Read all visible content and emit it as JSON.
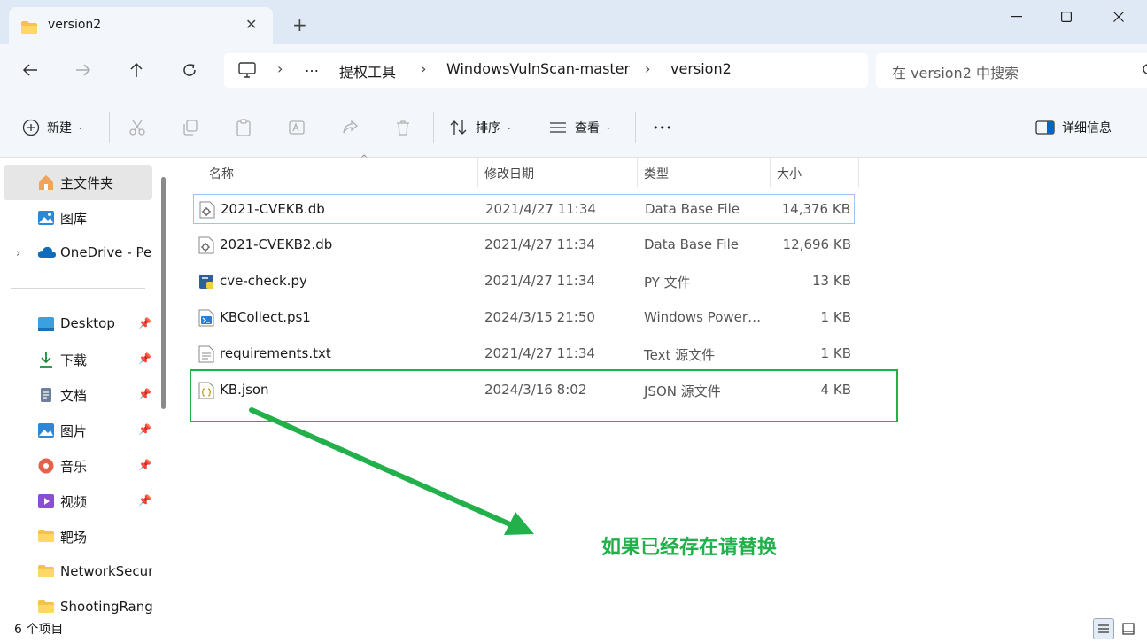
{
  "window": {
    "tab_title": "version2",
    "new_tab_symbol": "+"
  },
  "address": {
    "more": "…",
    "crumbs": [
      "提权工具",
      "WindowsVulnScan-master",
      "version2"
    ]
  },
  "search": {
    "placeholder": "在 version2 中搜索"
  },
  "toolbar": {
    "new_label": "新建",
    "sort_label": "排序",
    "view_label": "查看",
    "more_label": "•••",
    "details_label": "详细信息"
  },
  "sidebar": {
    "items": [
      {
        "label": "主文件夹",
        "icon": "home-icon"
      },
      {
        "label": "图库",
        "icon": "gallery-icon"
      },
      {
        "label": "OneDrive - Per",
        "icon": "onedrive-icon"
      },
      {
        "label": "Desktop",
        "icon": "desktop-icon",
        "pinned": true
      },
      {
        "label": "下载",
        "icon": "download-icon",
        "pinned": true
      },
      {
        "label": "文档",
        "icon": "documents-icon",
        "pinned": true
      },
      {
        "label": "图片",
        "icon": "pictures-icon",
        "pinned": true
      },
      {
        "label": "音乐",
        "icon": "music-icon",
        "pinned": true
      },
      {
        "label": "视频",
        "icon": "videos-icon",
        "pinned": true
      },
      {
        "label": "靶场",
        "icon": "folder-icon"
      },
      {
        "label": "NetworkSecuri",
        "icon": "folder-icon"
      },
      {
        "label": "ShootingRange",
        "icon": "folder-icon"
      }
    ]
  },
  "columns": {
    "name": "名称",
    "modified": "修改日期",
    "type": "类型",
    "size": "大小"
  },
  "files": [
    {
      "name": "2021-CVEKB.db",
      "modified": "2021/4/27 11:34",
      "type": "Data Base File",
      "size": "14,376 KB",
      "icon": "db-file-icon",
      "selected": true
    },
    {
      "name": "2021-CVEKB2.db",
      "modified": "2021/4/27 11:34",
      "type": "Data Base File",
      "size": "12,696 KB",
      "icon": "db-file-icon"
    },
    {
      "name": "cve-check.py",
      "modified": "2021/4/27 11:34",
      "type": "PY 文件",
      "size": "13 KB",
      "icon": "python-file-icon"
    },
    {
      "name": "KBCollect.ps1",
      "modified": "2024/3/15 21:50",
      "type": "Windows Power…",
      "size": "1 KB",
      "icon": "powershell-file-icon"
    },
    {
      "name": "requirements.txt",
      "modified": "2021/4/27 11:34",
      "type": "Text 源文件",
      "size": "1 KB",
      "icon": "text-file-icon"
    },
    {
      "name": "KB.json",
      "modified": "2024/3/16 8:02",
      "type": "JSON 源文件",
      "size": "4 KB",
      "icon": "json-file-icon"
    }
  ],
  "annotation": {
    "text": "如果已经存在请替换",
    "color": "#22b04b"
  },
  "status": {
    "item_count": "6 个项目"
  },
  "colors": {
    "accent": "#0067c0",
    "highlight": "#22b04b",
    "chrome": "#f3f7fb",
    "titlebar": "#dfe9f6"
  }
}
